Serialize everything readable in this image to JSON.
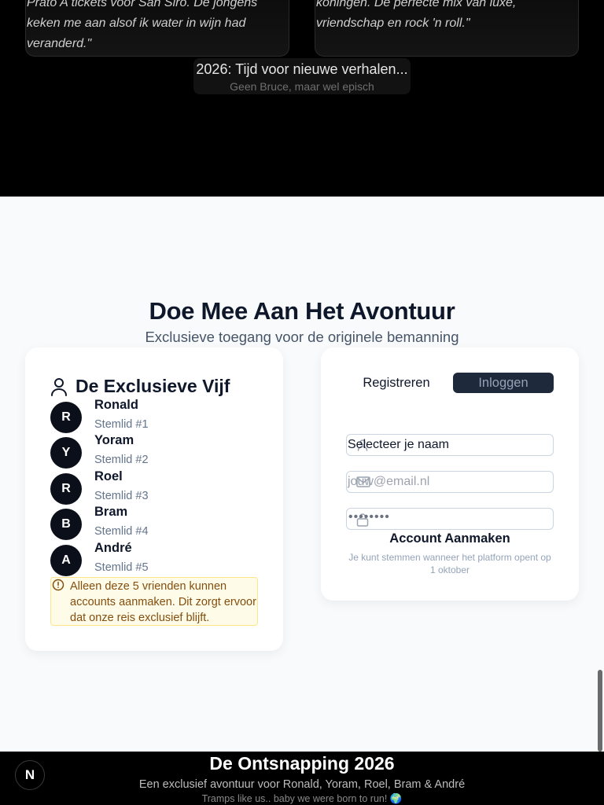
{
  "top_section": {
    "quote_left": "Prato A tickets voor San Siro. De jongens keken me aan alsof ik water in wijn had veranderd.\"",
    "quote_right": "koningen. De perfecte mix van luxe, vriendschap en rock 'n roll.\"",
    "pill_title": "2026: Tijd voor nieuwe verhalen...",
    "pill_subtitle": "Geen Bruce, maar wel episch"
  },
  "join": {
    "title": "Doe Mee Aan Het Avontuur",
    "subtitle": "Exclusieve toegang voor de originele bemanning"
  },
  "members_card": {
    "title": "De Exclusieve Vijf",
    "icon": "user-icon",
    "members": [
      {
        "initial": "R",
        "name": "Ronald",
        "role": "Stemlid #1"
      },
      {
        "initial": "Y",
        "name": "Yoram",
        "role": "Stemlid #2"
      },
      {
        "initial": "R",
        "name": "Roel",
        "role": "Stemlid #3"
      },
      {
        "initial": "B",
        "name": "Bram",
        "role": "Stemlid #4"
      },
      {
        "initial": "A",
        "name": "André",
        "role": "Stemlid #5"
      }
    ],
    "notice": "Alleen deze 5 vrienden kunnen accounts aanmaken. Dit zorgt ervoor dat onze reis exclusief blijft.",
    "notice_icon": "alert-circle-icon"
  },
  "auth_card": {
    "tabs": {
      "register": "Registreren",
      "login": "Inloggen"
    },
    "name_select_value": "Selecteer je naam",
    "email_placeholder": "jouw@email.nl",
    "password_value": "••••••••",
    "submit_label": "Account Aanmaken",
    "note": "Je kunt stemmen wanneer het platform opent op 1 oktober",
    "icons": [
      "user-icon",
      "mail-icon",
      "lock-icon"
    ]
  },
  "footer": {
    "title": "De Ontsnapping 2026",
    "subtitle": "Een exclusief avontuur voor Ronald, Yoram, Roel, Bram & André",
    "tagline": "Tramps like us.. baby we were born to run! 🌍",
    "badge": "N"
  },
  "colors": {
    "dark_bg": "#000000",
    "light_bg": "#f8fafc",
    "avatar_bg": "#0b0f1a",
    "active_tab_bg": "#1e293b",
    "notice_bg": "#fefce8",
    "notice_border": "#fde68a",
    "notice_text": "#854d0e"
  }
}
